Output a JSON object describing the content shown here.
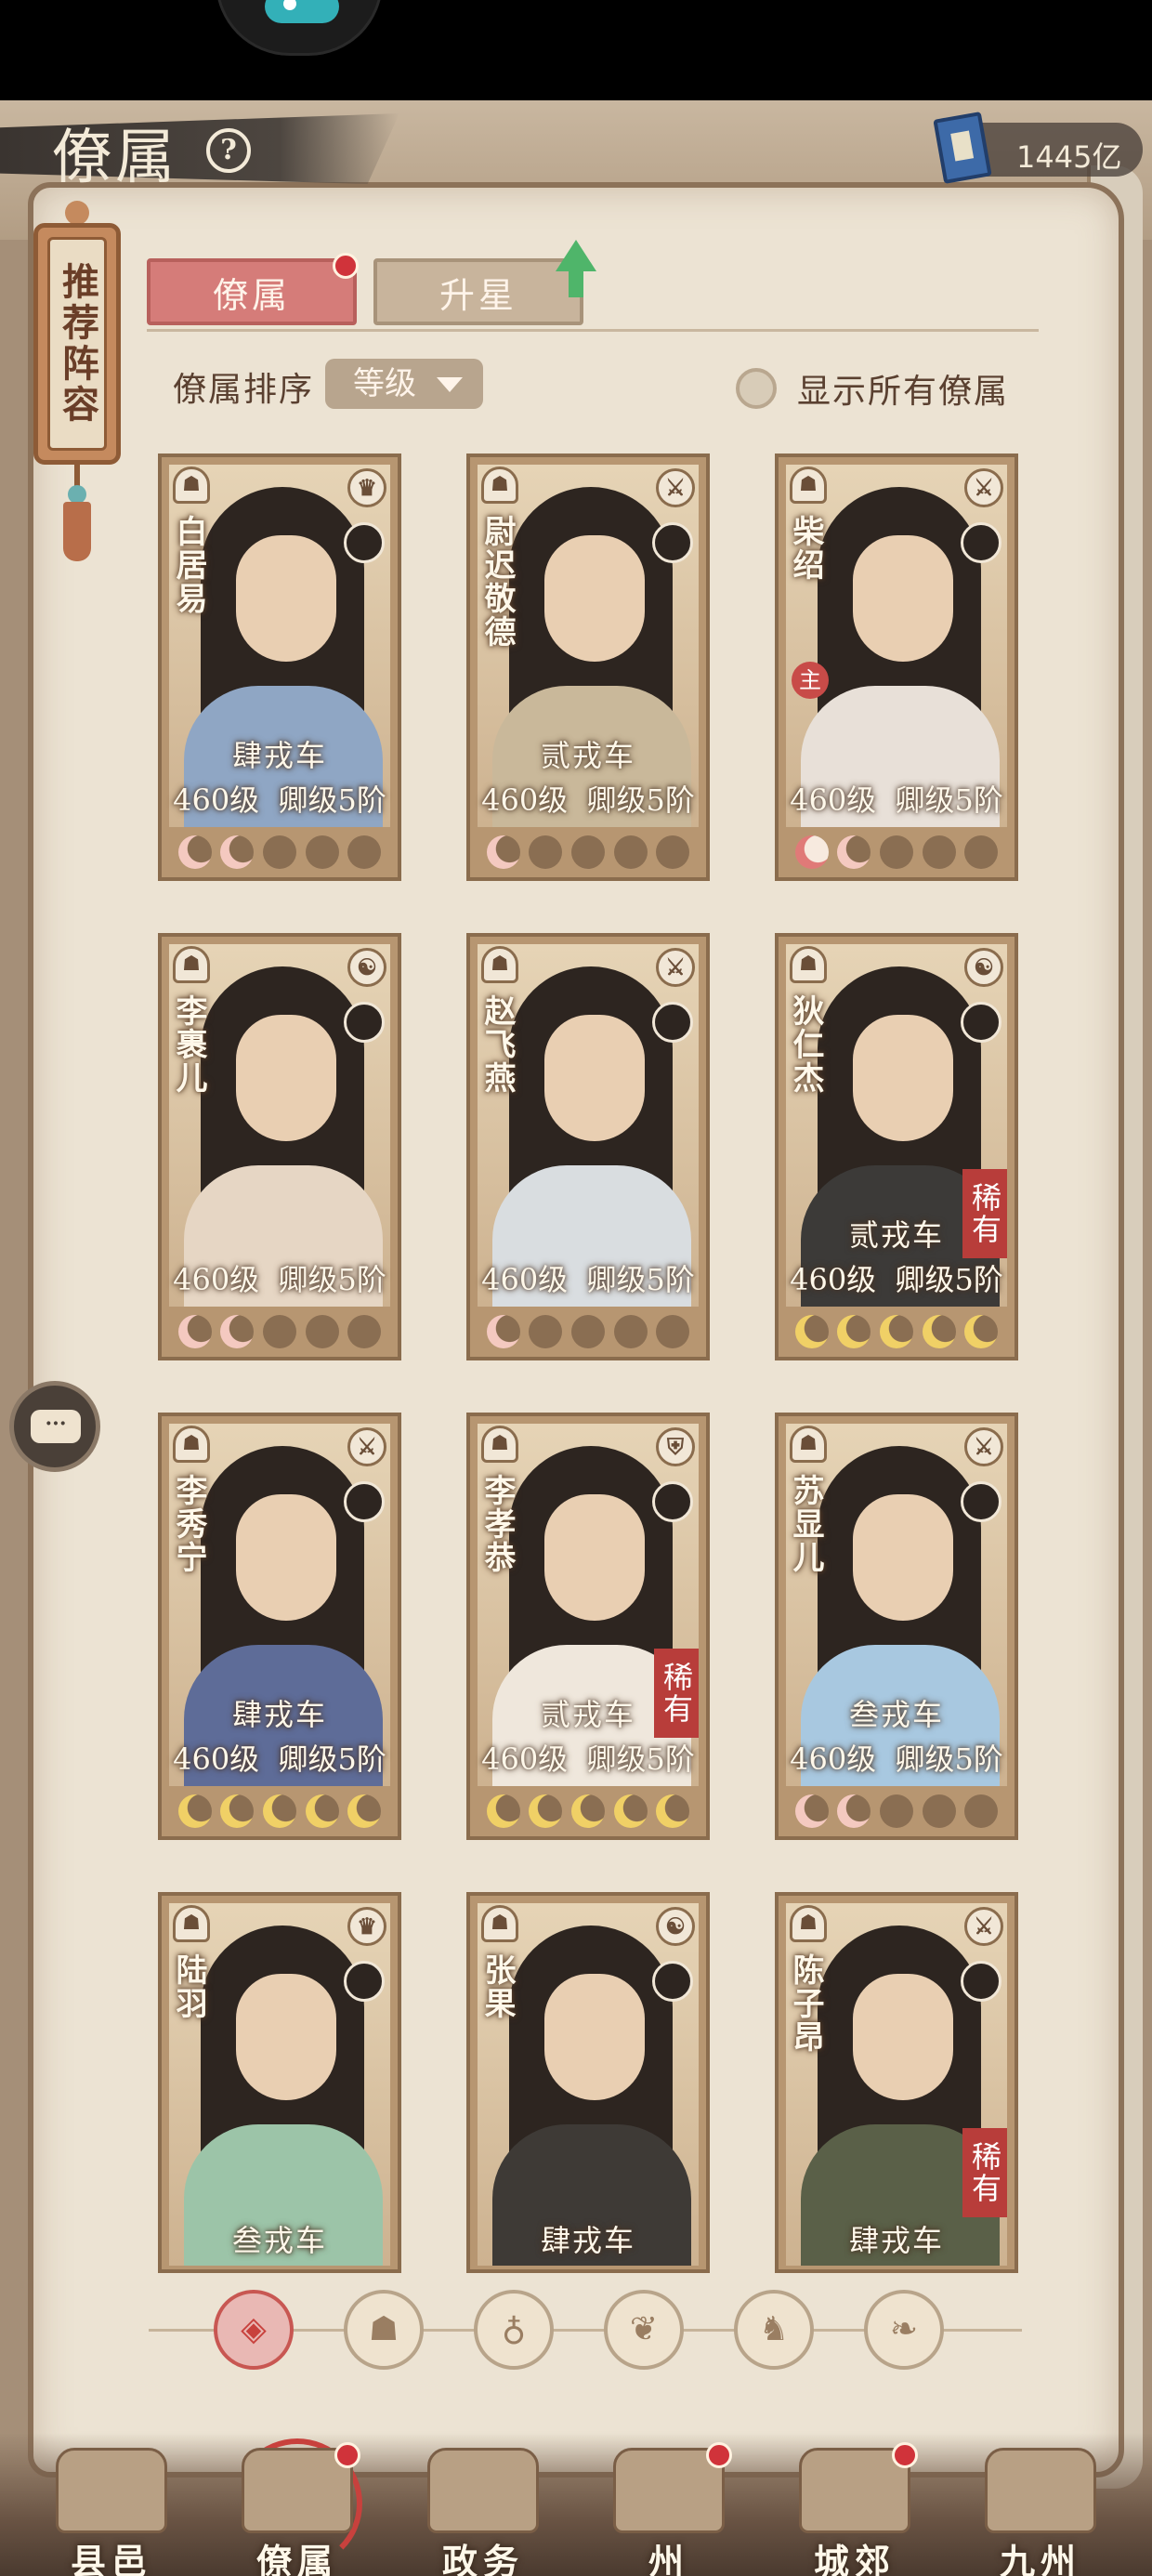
{
  "header": {
    "title": "僚属",
    "currency_value": "1445亿"
  },
  "recommend": {
    "label": "推荐阵容"
  },
  "tabs": [
    {
      "label": "僚属",
      "active": true,
      "has_dot": true
    },
    {
      "label": "升星",
      "active": false,
      "has_up_arrow": true
    }
  ],
  "sort": {
    "label": "僚属排序",
    "selected": "等级"
  },
  "toggle": {
    "label": "显示所有僚属",
    "checked": false
  },
  "cards": [
    {
      "name": "白居易",
      "badge": "肆戎车",
      "level": "460级",
      "rank": "卿级5阶",
      "rare": "",
      "zhu": "",
      "role_icon": "helmet-icon",
      "moons": [
        "pink",
        "pink",
        "empty",
        "empty",
        "empty"
      ],
      "robe": "#8fa6c4"
    },
    {
      "name": "尉迟敬德",
      "badge": "贰戎车",
      "level": "460级",
      "rank": "卿级5阶",
      "rare": "",
      "zhu": "",
      "role_icon": "sword-icon",
      "moons": [
        "pink",
        "empty",
        "empty",
        "empty",
        "empty"
      ],
      "robe": "#c9b89a"
    },
    {
      "name": "柴绍",
      "badge": "",
      "level": "460级",
      "rank": "卿级5阶",
      "rare": "",
      "zhu": "主",
      "role_icon": "sword-icon",
      "moons": [
        "pink-glow",
        "pink",
        "empty",
        "empty",
        "empty"
      ],
      "robe": "#e8e0d8"
    },
    {
      "name": "李裹儿",
      "badge": "",
      "level": "460级",
      "rank": "卿级5阶",
      "rare": "",
      "zhu": "",
      "role_icon": "yinyang-icon",
      "moons": [
        "pink",
        "pink",
        "empty",
        "empty",
        "empty"
      ],
      "robe": "#e6d6c4"
    },
    {
      "name": "赵飞燕",
      "badge": "",
      "level": "460级",
      "rank": "卿级5阶",
      "rare": "",
      "zhu": "",
      "role_icon": "sword-icon",
      "moons": [
        "pink",
        "empty",
        "empty",
        "empty",
        "empty"
      ],
      "robe": "#d9dde0"
    },
    {
      "name": "狄仁杰",
      "badge": "贰戎车",
      "level": "460级",
      "rank": "卿级5阶",
      "rare": "稀有",
      "zhu": "",
      "role_icon": "yinyang-icon",
      "moons": [
        "yellow",
        "yellow",
        "yellow",
        "yellow",
        "yellow"
      ],
      "robe": "#3c3a38"
    },
    {
      "name": "李秀宁",
      "badge": "肆戎车",
      "level": "460级",
      "rank": "卿级5阶",
      "rare": "",
      "zhu": "",
      "role_icon": "sword-icon",
      "moons": [
        "yellow",
        "yellow",
        "yellow",
        "yellow",
        "yellow"
      ],
      "robe": "#5e6c98"
    },
    {
      "name": "李孝恭",
      "badge": "贰戎车",
      "level": "460级",
      "rank": "卿级5阶",
      "rare": "稀有",
      "zhu": "",
      "role_icon": "shield-icon",
      "moons": [
        "yellow",
        "yellow",
        "yellow",
        "yellow",
        "yellow"
      ],
      "robe": "#efe7dc"
    },
    {
      "name": "苏显儿",
      "badge": "叁戎车",
      "level": "460级",
      "rank": "卿级5阶",
      "rare": "",
      "zhu": "",
      "role_icon": "sword-icon",
      "moons": [
        "pink",
        "pink",
        "empty",
        "empty",
        "empty"
      ],
      "robe": "#a8c8e0"
    },
    {
      "name": "陆羽",
      "badge": "叁戎车",
      "level": "",
      "rank": "",
      "rare": "",
      "zhu": "",
      "role_icon": "helmet-icon",
      "moons": [],
      "robe": "#9cc4a8"
    },
    {
      "name": "张果",
      "badge": "肆戎车",
      "level": "",
      "rank": "",
      "rare": "",
      "zhu": "",
      "role_icon": "yinyang-icon",
      "moons": [],
      "robe": "#3e3a36"
    },
    {
      "name": "陈子昂",
      "badge": "肆戎车",
      "level": "",
      "rank": "",
      "rare": "稀有",
      "zhu": "",
      "role_icon": "sword-icon",
      "moons": [],
      "robe": "#5a6048"
    }
  ],
  "filters": [
    {
      "icon": "all-factions-icon",
      "glyph": "◈",
      "active": true
    },
    {
      "icon": "faction-tiger-icon",
      "glyph": "☗",
      "active": false
    },
    {
      "icon": "faction-gourd-icon",
      "glyph": "♁",
      "active": false
    },
    {
      "icon": "faction-fan-icon",
      "glyph": "❦",
      "active": false
    },
    {
      "icon": "faction-beast-icon",
      "glyph": "♞",
      "active": false
    },
    {
      "icon": "faction-leaf-icon",
      "glyph": "❧",
      "active": false
    }
  ],
  "bottom_nav": [
    {
      "label": "县邑",
      "dot": false,
      "active": false
    },
    {
      "label": "僚属",
      "dot": true,
      "active": true
    },
    {
      "label": "政务",
      "dot": false,
      "active": false
    },
    {
      "label": "州",
      "dot": true,
      "active": false
    },
    {
      "label": "城郊",
      "dot": true,
      "active": false
    },
    {
      "label": "九州",
      "dot": false,
      "active": false
    }
  ],
  "chat": {
    "glyph": "···"
  },
  "colors": {
    "accent_red": "#d57c79",
    "rare_red": "#b83d3a",
    "dot_red": "#d0333a",
    "paper": "#ece3d3"
  }
}
